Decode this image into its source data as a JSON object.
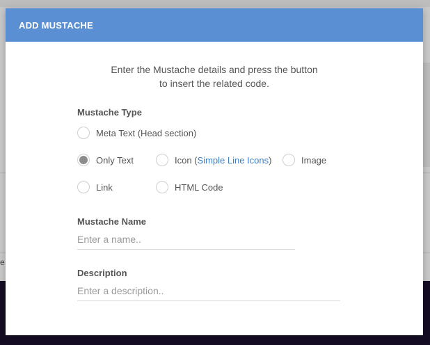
{
  "background": {
    "edge_text": "e"
  },
  "modal": {
    "title": "ADD MUSTACHE",
    "intro_line1": "Enter the Mustache details and press the button",
    "intro_line2": "to insert the related code.",
    "type_section": {
      "label": "Mustache Type",
      "selected": "Only Text",
      "options": {
        "meta_text": "Meta Text (Head section)",
        "only_text": "Only Text",
        "icon_prefix": "Icon (",
        "icon_link": "Simple Line Icons",
        "icon_suffix": ")",
        "image": "Image",
        "link": "Link",
        "html_code": "HTML Code"
      }
    },
    "name_field": {
      "label": "Mustache Name",
      "placeholder": "Enter a name..",
      "value": ""
    },
    "description_field": {
      "label": "Description",
      "placeholder": "Enter a description..",
      "value": ""
    }
  },
  "colors": {
    "header": "#5b8fd4",
    "link": "#3f7fc4",
    "overlay_dark": "#150d24"
  }
}
